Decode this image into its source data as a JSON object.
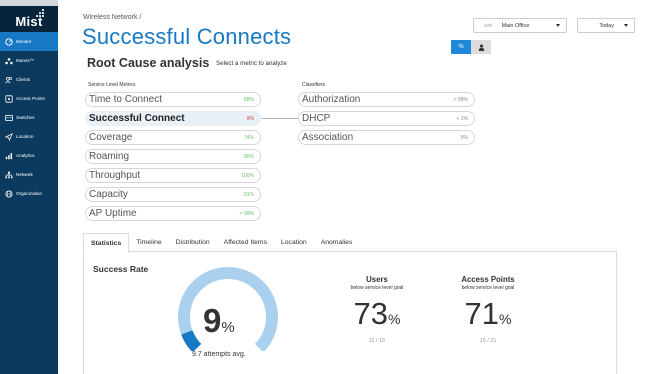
{
  "brand": {
    "name": "Mist"
  },
  "nav": [
    {
      "label": "Monitor",
      "icon": "monitor-icon",
      "active": true
    },
    {
      "label": "Marvis™",
      "icon": "marvis-icon",
      "active": false
    },
    {
      "label": "Clients",
      "icon": "clients-icon",
      "active": false
    },
    {
      "label": "Access Points",
      "icon": "access-points-icon",
      "active": false
    },
    {
      "label": "Switches",
      "icon": "switches-icon",
      "active": false
    },
    {
      "label": "Location",
      "icon": "location-icon",
      "active": false
    },
    {
      "label": "Analytics",
      "icon": "analytics-icon",
      "active": false
    },
    {
      "label": "Network",
      "icon": "network-icon",
      "active": false
    },
    {
      "label": "Organization",
      "icon": "organization-icon",
      "active": false
    }
  ],
  "header": {
    "breadcrumb": "Wireless Network /",
    "title": "Successful Connects",
    "site_label": "site",
    "site_value": "Main Office",
    "time_value": "Today",
    "toggle_percent": "%",
    "toggle_user_icon": "user-icon"
  },
  "rca": {
    "title": "Root Cause analysis",
    "subtitle": "Select a metric to analyze",
    "slm_label": "Service Level Metrics",
    "classifiers_label": "Classifiers",
    "metrics": [
      {
        "name": "Time to Connect",
        "value": "88%"
      },
      {
        "name": "Successful Connect",
        "value": "9%"
      },
      {
        "name": "Coverage",
        "value": "74%"
      },
      {
        "name": "Roaming",
        "value": "95%"
      },
      {
        "name": "Throughput",
        "value": "100%"
      },
      {
        "name": "Capacity",
        "value": "91%"
      },
      {
        "name": "AP Uptime",
        "value": "> 99%"
      }
    ],
    "classifiers": [
      {
        "name": "Authorization",
        "value": "> 99%"
      },
      {
        "name": "DHCP",
        "value": "< 1%"
      },
      {
        "name": "Association",
        "value": "0%"
      }
    ]
  },
  "tabs": [
    "Statistics",
    "Timeline",
    "Distribution",
    "Affected Items",
    "Location",
    "Anomalies"
  ],
  "stats": {
    "title": "Success Rate",
    "rate_value": "9",
    "rate_unit": "%",
    "rate_fraction": 0.09,
    "attempts": "9.7 attempts avg.",
    "users": {
      "title": "Users",
      "subtitle": "below service level goal",
      "value": "73",
      "unit": "%",
      "fraction": "11 / 15"
    },
    "aps": {
      "title": "Access Points",
      "subtitle": "below service level goal",
      "value": "71",
      "unit": "%",
      "fraction": "15 / 21"
    }
  },
  "colors": {
    "sidebar": "#0b3a5e",
    "accent": "#1779c4",
    "gauge_track": "#a9d0ee",
    "gauge_fill": "#1779c4",
    "good": "#6abf69",
    "bad": "#e23b3b"
  }
}
